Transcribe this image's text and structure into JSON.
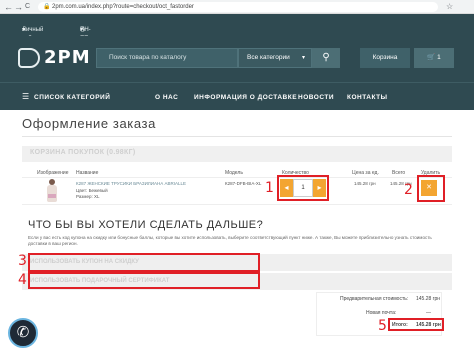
{
  "browser": {
    "back_glyph": "←",
    "forward_glyph": "→",
    "reload_glyph": "C",
    "url": "2pm.com.ua/index.php?route=checkout/oct_fastorder",
    "lock_glyph": "🔒",
    "star_glyph": "☆"
  },
  "topbar": {
    "account_label": "Личный кабинет",
    "account_chevron": "▾",
    "hours_icon": "◷",
    "hours_text": "ПН-ПТ: 09:00 - 18:00",
    "hours_chevron": "▾"
  },
  "header": {
    "logo_text": "2PM",
    "search_placeholder": "Поиск товара по каталогу",
    "category_select": "Все категории",
    "select_chevron": "▾",
    "search_icon": "search-icon",
    "search_glyph": "⚲",
    "cart_label": "Корзина",
    "cart_glyph": "🛒",
    "cart_count": "1"
  },
  "nav": {
    "menu_glyph": "☰",
    "categories_label": "СПИСОК КАТЕГОРИЙ",
    "items": [
      "О НАС",
      "ИНФОРМАЦИЯ О ДОСТАВКЕ",
      "НОВОСТИ",
      "КОНТАКТЫ"
    ]
  },
  "page": {
    "title": "Оформление заказа",
    "cart_panel_title": "КОРЗИНА ПОКУПОК (0.98КГ)"
  },
  "cart_table": {
    "headers": [
      "Изображение",
      "Название",
      "Модель",
      "Количество",
      "Цена за ед.",
      "Всего",
      "Удалить"
    ],
    "rows": [
      {
        "name": "К287 ЖЕНСКИЕ ТРУСИКИ БРАЗИЛИАНА ABRIALLE",
        "color": "Цвет: Бежевый",
        "size": "Размер: XL",
        "model": "К287-DFB-BIA-XL",
        "quantity": "1",
        "minus_glyph": "◂",
        "plus_glyph": "▸",
        "price": "145.28 грн",
        "total": "145.28 грн",
        "delete_glyph": "✕"
      }
    ]
  },
  "next_section": {
    "title": "ЧТО БЫ ВЫ ХОТЕЛИ СДЕЛАТЬ ДАЛЬШЕ?",
    "description": "Если у вас есть код купона на скидку или бонусные баллы, которые вы хотите использовать, выберите соответствующий пункт ниже. А также, Вы можете приблизительно узнать стоимость доставки в ваш регион.",
    "accordion": [
      "ИСПОЛЬЗОВАТЬ КУПОН НА СКИДКУ",
      "ИСПОЛЬЗОВАТЬ ПОДАРОЧНЫЙ СЕРТИФИКАТ"
    ]
  },
  "totals": {
    "rows": [
      {
        "label": "Предварительная стоимость:",
        "value": "145.28 грн"
      },
      {
        "label": "Новая почта:",
        "value": "—"
      },
      {
        "label": "Итого:",
        "value": "145.28 грн"
      }
    ]
  },
  "annotations": {
    "labels": [
      "1",
      "2",
      "3",
      "4",
      "5"
    ],
    "color": "#e01f26"
  },
  "colors": {
    "header_bg": "#2f4a51",
    "accent_orange": "#f3a531",
    "panel_bg": "#f0f0f0"
  },
  "phone": {
    "glyph": "✆"
  }
}
